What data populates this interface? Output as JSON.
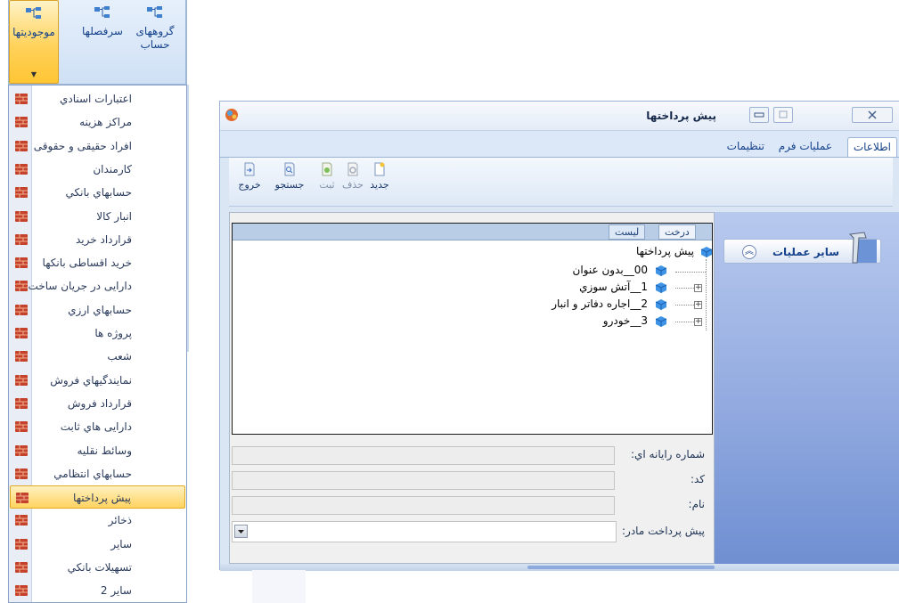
{
  "ribbon": {
    "buttons": [
      {
        "label": "موجودیتها",
        "active": true,
        "icon": "hierarchy-icon"
      },
      {
        "label": "سرفصلها",
        "active": false,
        "icon": "hierarchy-icon"
      },
      {
        "label": "گروههای حساب",
        "active": false,
        "icon": "hierarchy-icon"
      }
    ]
  },
  "menu": {
    "items": [
      {
        "label": "اعتبارات اسنادي"
      },
      {
        "label": "مراکز هزینه"
      },
      {
        "label": "افراد حقیقی و حقوقی"
      },
      {
        "label": "کارمندان"
      },
      {
        "label": "حسابهاي بانکي"
      },
      {
        "label": "انبار کالا"
      },
      {
        "label": "قرارداد خرید"
      },
      {
        "label": "خرید اقساطی بانکها"
      },
      {
        "label": "دارایی در جریان ساخت"
      },
      {
        "label": "حسابهاي ارزي"
      },
      {
        "label": "پروژه ها"
      },
      {
        "label": "شعب"
      },
      {
        "label": "نمایندگیهاي فروش"
      },
      {
        "label": "قرارداد فروش"
      },
      {
        "label": "دارایی هاي ثابت"
      },
      {
        "label": "وسائط نقلیه"
      },
      {
        "label": "حسابهاي انتظامي"
      },
      {
        "label": "پیش پرداختها",
        "selected": true
      },
      {
        "label": "ذخائر"
      },
      {
        "label": "ساير"
      },
      {
        "label": "تسهیلات بانکي"
      },
      {
        "label": "ساير 2"
      }
    ],
    "icon": "brick-icon",
    "selected_color": "#ffd35f"
  },
  "window": {
    "title": "پیش پرداختها",
    "tabs": [
      {
        "label": "اطلاعات",
        "active": true
      },
      {
        "label": "عملیات فرم",
        "active": false
      },
      {
        "label": "تنظیمات",
        "active": false
      }
    ],
    "toolbar": [
      {
        "label": "جدید",
        "enabled": true,
        "icon": "new-document-icon"
      },
      {
        "label": "حذف",
        "enabled": false,
        "icon": "delete-icon"
      },
      {
        "label": "ثبت",
        "enabled": false,
        "icon": "save-icon"
      },
      {
        "label": "جستجو",
        "enabled": true,
        "icon": "search-icon"
      },
      {
        "label": "خروج",
        "enabled": true,
        "icon": "exit-icon"
      }
    ],
    "view_tabs": {
      "tree": "درخت",
      "list": "لیست"
    },
    "tree": {
      "root": "پیش پرداختها",
      "nodes": [
        {
          "label": "00__بدون عنوان",
          "expandable": false
        },
        {
          "label": "1__آتش سوزي",
          "expandable": true
        },
        {
          "label": "2__اجاره دفاتر و انبار",
          "expandable": true
        },
        {
          "label": "3__خودرو",
          "expandable": true
        }
      ]
    },
    "fields": {
      "computer_no_label": "شماره رایانه اي:",
      "computer_no_value": "",
      "code_label": "کد:",
      "code_value": "",
      "name_label": "نام:",
      "name_value": "",
      "parent_label": "پیش پرداخت مادر:",
      "parent_value": ""
    },
    "side_panel": {
      "title": "ساير عمليات",
      "collapse_icon": "double-chevron-up-icon",
      "tool_icon": "hammer-icon"
    }
  },
  "colors": {
    "ribbon_bg": "#cfe0f5",
    "accent": "#15428b",
    "side_panel": "#8ea7de"
  }
}
